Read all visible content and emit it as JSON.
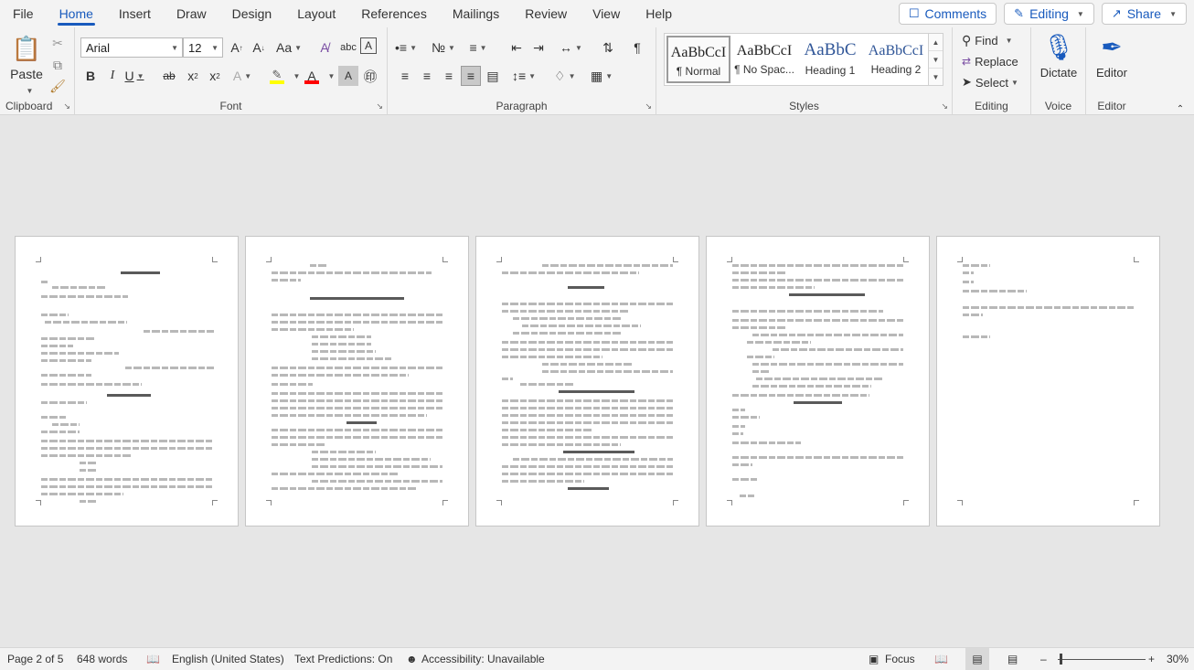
{
  "menu": {
    "tabs": [
      "File",
      "Home",
      "Insert",
      "Draw",
      "Design",
      "Layout",
      "References",
      "Mailings",
      "Review",
      "View",
      "Help"
    ],
    "comments": "Comments",
    "editing": "Editing",
    "share": "Share"
  },
  "ribbon": {
    "clipboard": {
      "label": "Clipboard",
      "paste": "Paste"
    },
    "font": {
      "label": "Font",
      "family": "Arial",
      "size": "12"
    },
    "paragraph": {
      "label": "Paragraph"
    },
    "styles": {
      "label": "Styles",
      "items": [
        {
          "sample": "AaBbCcI",
          "name": "¶ Normal"
        },
        {
          "sample": "AaBbCcI",
          "name": "¶ No Spac..."
        },
        {
          "sample": "AaBbC",
          "name": "Heading 1"
        },
        {
          "sample": "AaBbCcI",
          "name": "Heading 2"
        }
      ]
    },
    "editing": {
      "label": "Editing",
      "find": "Find",
      "replace": "Replace",
      "select": "Select"
    },
    "voice": {
      "label": "Voice",
      "dictate": "Dictate"
    },
    "editor": {
      "label": "Editor",
      "editor": "Editor"
    }
  },
  "status": {
    "page": "Page 2 of 5",
    "words": "648 words",
    "language": "English (United States)",
    "predictions": "Text Predictions: On",
    "accessibility": "Accessibility: Unavailable",
    "focus": "Focus",
    "zoom": "30%"
  },
  "colors": {
    "accent": "#185abd",
    "highlight": "#ffff00",
    "font_color": "#ff0000"
  }
}
